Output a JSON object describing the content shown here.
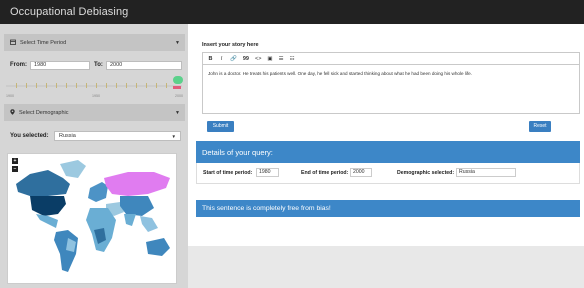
{
  "app": {
    "title": "Occupational Debiasing"
  },
  "time_period": {
    "header": "Select Time Period",
    "from_label": "From:",
    "from_value": "1980",
    "to_label": "To:",
    "to_value": "2000",
    "slider_min_label": "1900",
    "slider_mid_label": "1950",
    "slider_max_label": "2000"
  },
  "demographic": {
    "header": "Select Demographic",
    "you_selected_label": "You selected:",
    "selected_value": "Russia"
  },
  "map": {
    "zoom_in": "+",
    "zoom_out": "−",
    "highlight_color": "#e07cf0"
  },
  "story": {
    "label": "Insert your story here",
    "toolbar": [
      "B",
      "I",
      "🔗",
      "99",
      "<>",
      "▣",
      "☰",
      "☷"
    ],
    "text": "John is a doctor. He treats his patients well. One day, he fell sick and started thinking about what he had been doing his whole life."
  },
  "buttons": {
    "submit": "Submit",
    "reset": "Reset"
  },
  "query": {
    "title": "Details of your query:",
    "start_label": "Start of time period:",
    "start_value": "1980",
    "end_label": "End of time period:",
    "end_value": "2000",
    "demo_label": "Demographic selected:",
    "demo_value": "Russia"
  },
  "result": {
    "message": "This sentence is completely free from bias!"
  },
  "colors": {
    "accent": "#3d87c8",
    "topbar": "#222222",
    "slider_handle": "#5bd18b"
  }
}
